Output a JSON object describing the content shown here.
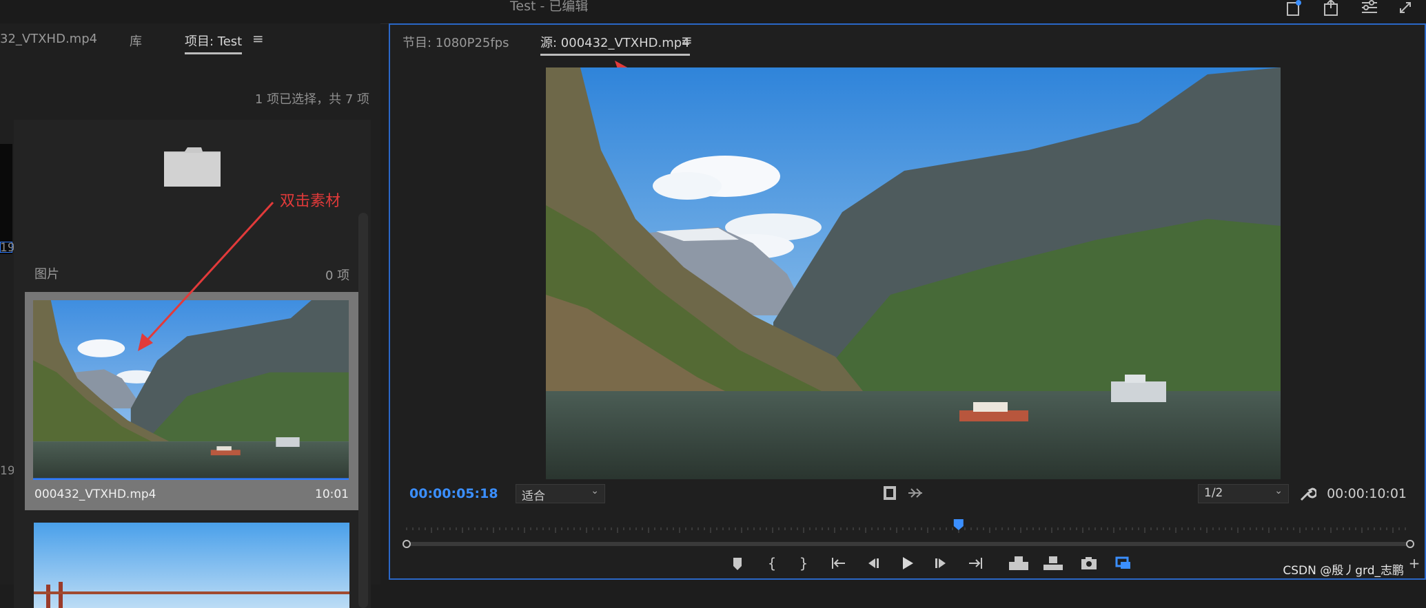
{
  "app": {
    "title": "Test - 已编辑"
  },
  "left_panel": {
    "tabs": [
      {
        "label": "32_VTXHD.mp4"
      },
      {
        "label": "库"
      },
      {
        "label": "项目: Test",
        "active": true
      }
    ],
    "selection_status": "1 项已选择，共 7 项",
    "edge_numbers": [
      "19",
      "19"
    ],
    "bin": {
      "name": "图片",
      "count": "0 项"
    },
    "clip": {
      "name": "000432_VTXHD.mp4",
      "duration": "10:01"
    },
    "annotation": "双击素材"
  },
  "monitor": {
    "tabs": [
      {
        "label": "节目: 1080P25fps"
      },
      {
        "label": "源: 000432_VTXHD.mp4",
        "active": true
      }
    ],
    "current_timecode": "00:00:05:18",
    "zoom_select": "适合",
    "resolution_select": "1/2",
    "duration": "00:00:10:01",
    "playhead_fraction": 0.55
  },
  "icons": [
    "export-icon",
    "share-icon",
    "workspace-icon",
    "fullscreen-icon",
    "marker-icon",
    "mark-in-icon",
    "mark-out-icon",
    "go-to-in-icon",
    "step-back-icon",
    "play-icon",
    "step-forward-icon",
    "go-to-out-icon",
    "insert-icon",
    "overwrite-icon",
    "camera-icon",
    "loop-icon",
    "settings-wrench-icon"
  ],
  "watermark": "CSDN @殷丿grd_志鹏",
  "accent": "#2a67c7",
  "timecode_color": "#3b8fff",
  "annotation_color": "#e23a3a"
}
